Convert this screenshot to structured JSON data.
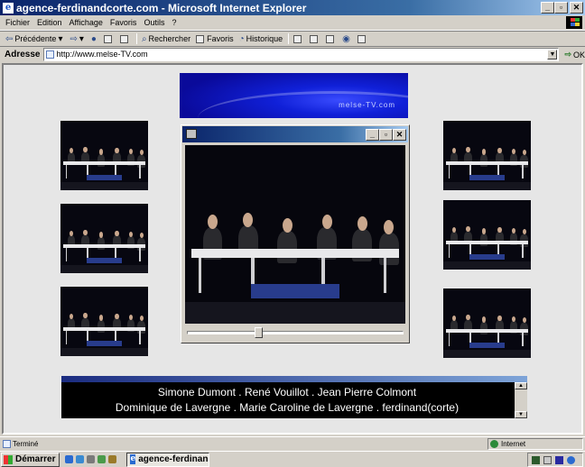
{
  "window": {
    "title": "agence-ferdinandcorte.com - Microsoft Internet Explorer",
    "minimize_glyph": "_",
    "restore_glyph": "▫",
    "close_glyph": "✕"
  },
  "menu": [
    "Fichier",
    "Edition",
    "Affichage",
    "Favoris",
    "Outils",
    "?"
  ],
  "toolbar": {
    "back_label": "Précédente",
    "search_label": "Rechercher",
    "favorites_label": "Favoris",
    "history_label": "Historique"
  },
  "address": {
    "label": "Adresse",
    "url": "http://www.melse-TV.com",
    "go_label": "OK"
  },
  "page": {
    "banner_logo": "melse-TV.com",
    "credits_line1": "Simone Dumont . René Vouillot . Jean Pierre Colmont",
    "credits_line2": "Dominique de Lavergne . Marie Caroline de Lavergne . ferdinand(corte)"
  },
  "player": {
    "seek_progress": 0.33
  },
  "status": {
    "text": "Terminé",
    "zone": "Internet"
  },
  "taskbar": {
    "start_label": "Démarrer",
    "task_label": "agence-ferdinandcorte..."
  },
  "colors": {
    "title_gradient_start": "#0a246a",
    "banner_blue": "#1020d8",
    "desktop_gray": "#d4d0c8"
  }
}
